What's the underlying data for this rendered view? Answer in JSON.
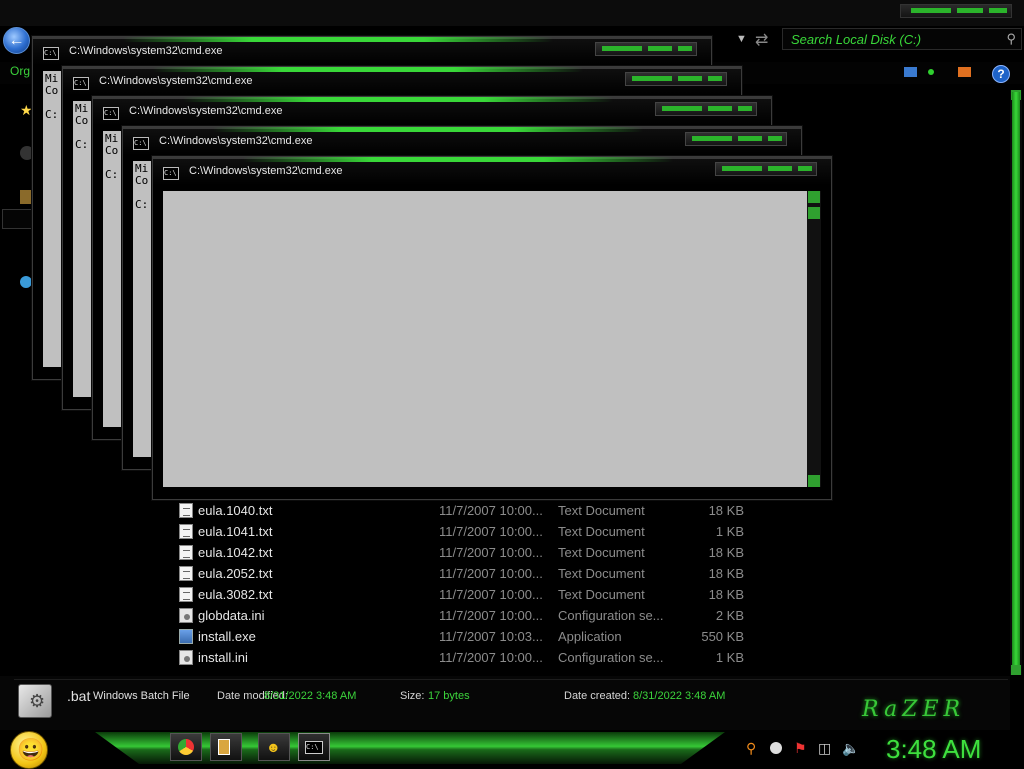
{
  "explorer": {
    "search_placeholder": "Search Local Disk (C:)",
    "organize_label": "Org",
    "files": [
      {
        "name": "eula.1040.txt",
        "date": "11/7/2007 10:00...",
        "type": "Text Document",
        "size": "18 KB",
        "icon": "text-document-icon"
      },
      {
        "name": "eula.1041.txt",
        "date": "11/7/2007 10:00...",
        "type": "Text Document",
        "size": "1 KB",
        "icon": "text-document-icon"
      },
      {
        "name": "eula.1042.txt",
        "date": "11/7/2007 10:00...",
        "type": "Text Document",
        "size": "18 KB",
        "icon": "text-document-icon"
      },
      {
        "name": "eula.2052.txt",
        "date": "11/7/2007 10:00...",
        "type": "Text Document",
        "size": "18 KB",
        "icon": "text-document-icon"
      },
      {
        "name": "eula.3082.txt",
        "date": "11/7/2007 10:00...",
        "type": "Text Document",
        "size": "18 KB",
        "icon": "text-document-icon"
      },
      {
        "name": "globdata.ini",
        "date": "11/7/2007 10:00...",
        "type": "Configuration se...",
        "size": "2 KB",
        "icon": "config-file-icon"
      },
      {
        "name": "install.exe",
        "date": "11/7/2007 10:03...",
        "type": "Application",
        "size": "550 KB",
        "icon": "application-icon"
      },
      {
        "name": "install.ini",
        "date": "11/7/2007 10:00...",
        "type": "Configuration se...",
        "size": "1 KB",
        "icon": "config-file-icon"
      }
    ],
    "details": {
      "name": ".bat",
      "type": "Windows Batch File",
      "modified_label": "Date modified:",
      "modified_value": "8/31/2022 3:48 AM",
      "size_label": "Size:",
      "size_value": "17 bytes",
      "created_label": "Date created:",
      "created_value": "8/31/2022 3:48 AM"
    },
    "brand_logo_text": "RaZER"
  },
  "cmd_windows": [
    {
      "title": "C:\\Windows\\system32\\cmd.exe",
      "lines": [
        "Mi",
        "Co",
        "",
        "C:"
      ]
    },
    {
      "title": "C:\\Windows\\system32\\cmd.exe",
      "lines": [
        "Mi",
        "Co",
        "",
        "C:"
      ]
    },
    {
      "title": "C:\\Windows\\system32\\cmd.exe",
      "lines": [
        "Mi",
        "Co",
        "",
        "C:"
      ]
    },
    {
      "title": "C:\\Windows\\system32\\cmd.exe",
      "lines": [
        "Mi",
        "Co",
        "",
        "C:"
      ]
    },
    {
      "title": "C:\\Windows\\system32\\cmd.exe",
      "lines": []
    }
  ],
  "taskbar": {
    "clock": "3:48 AM",
    "buttons": [
      "chrome-icon",
      "file-explorer-icon",
      "smiley-icon",
      "cmd-icon"
    ],
    "tray_icons": [
      "search-tray-icon",
      "messenger-icon",
      "flag-icon",
      "network-icon",
      "volume-icon"
    ]
  },
  "colors": {
    "accent": "#39d839",
    "background": "#000000"
  }
}
